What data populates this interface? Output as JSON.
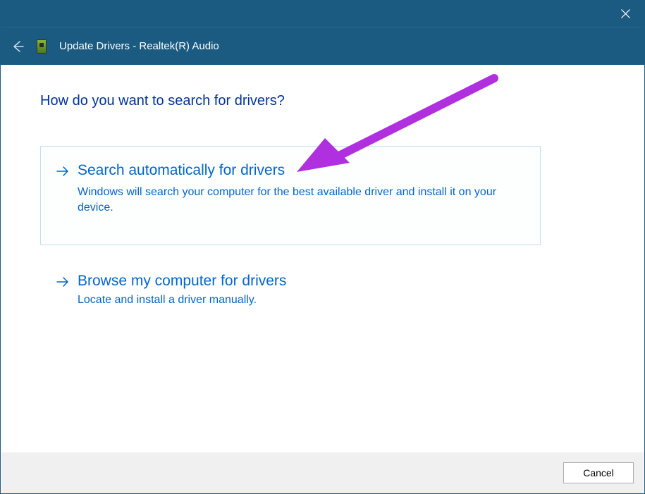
{
  "window": {
    "title": "Update Drivers - Realtek(R) Audio"
  },
  "heading": "How do you want to search for drivers?",
  "options": [
    {
      "title": "Search automatically for drivers",
      "description": "Windows will search your computer for the best available driver and install it on your device."
    },
    {
      "title": "Browse my computer for drivers",
      "description": "Locate and install a driver manually."
    }
  ],
  "footer": {
    "cancel": "Cancel"
  }
}
